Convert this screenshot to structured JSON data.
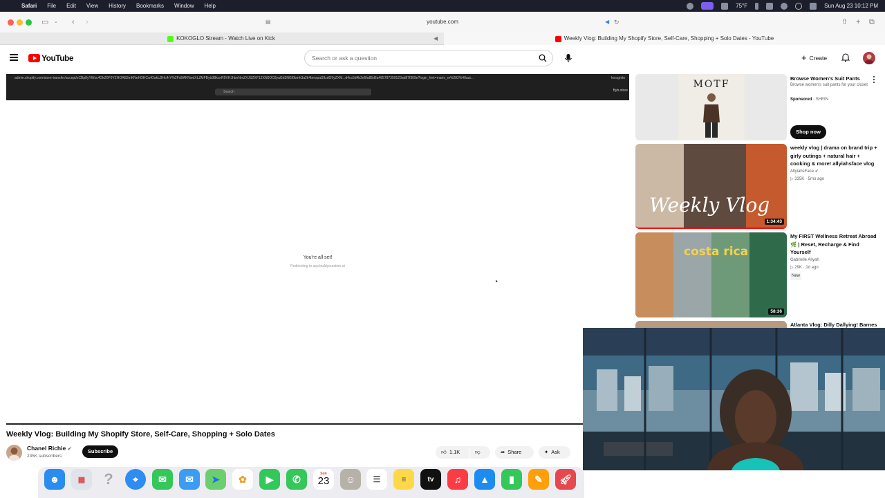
{
  "menubar": {
    "items": [
      "Safari",
      "File",
      "Edit",
      "View",
      "History",
      "Bookmarks",
      "Window",
      "Help"
    ],
    "weather": "75°F",
    "datetime": "Sun Aug 23  10:12 PM"
  },
  "browser": {
    "address": "youtube.com",
    "tabs": [
      {
        "label": "KOKOGLO Stream - Watch Live on Kick"
      },
      {
        "label": "Weekly Vlog: Building My Shopify Store, Self-Care, Shopping + Solo Dates - YouTube"
      }
    ]
  },
  "youtube": {
    "logo": "YouTube",
    "search_placeholder": "Search or ask a question",
    "create_label": "Create"
  },
  "player": {
    "inner_url": "admin.shopify.com/store-transfer/accept/zCBp8yYWsc4OkZ0F0YZHOAB3mKNeHDHCwfOakU3Hc4rY%2FxBAKNwdXLZMFByb3BkcnR5VHJhbnNmZXJSZXF1ZXN0OC8yaGd3NGl0bmh3a2k4bmxpaS9zdG9yZXM...d4cc5d4b2e5fa85d6a485787359123ad87f309e?login_hint=mario_m%282%40aut...",
    "inner_incognito": "Incognito",
    "inner_search": "Search",
    "inner_store": "Byb-store",
    "status_title": "You're all set!",
    "status_sub": "Redirecting to app.buildyourstore.ai"
  },
  "video": {
    "title": "Weekly Vlog: Building My Shopify Store, Self-Care, Shopping + Solo Dates",
    "channel": "Chanel Richie",
    "subscribers": "235K subscribers",
    "subscribe_label": "Subscribe",
    "likes": "1.1K",
    "share_label": "Share",
    "ask_label": "Ask"
  },
  "sidebar": {
    "ad": {
      "brand_text": "MOTF",
      "title": "Browse Women's Suit Pants",
      "desc": "Browse women's suit pants for your closet",
      "sponsor": "Sponsored",
      "advertiser": "SHEIN",
      "cta": "Shop now"
    },
    "videos": [
      {
        "title": "weekly vlog | drama on brand trip + girly outings + natural hair + cooking & more! allyiahsface vlog",
        "channel": "AllyiahsFace",
        "views": "335K",
        "age": "5mo ago",
        "duration": "1:34:43",
        "thumb_text": "Weekly Vlog"
      },
      {
        "title": "My FIRST Wellness Retreat Abroad 🌿 | Reset, Recharge & Find Yourself",
        "channel": "Gabrielle Aliyah",
        "views": "29K",
        "age": "1d ago",
        "badge": "New",
        "duration": "58:36",
        "thumb_text": "costa rica"
      },
      {
        "title": "Atlanta Vlog: Dilly Dallying! Barnes"
      }
    ]
  },
  "dock": {
    "calendar_month": "Sun",
    "calendar_day": "23",
    "tv_label": "tv"
  },
  "colors": {
    "yt_red": "#ff0000",
    "menubar_bg": "#1c1f2b",
    "accent_purple": "#7d5ff0"
  }
}
